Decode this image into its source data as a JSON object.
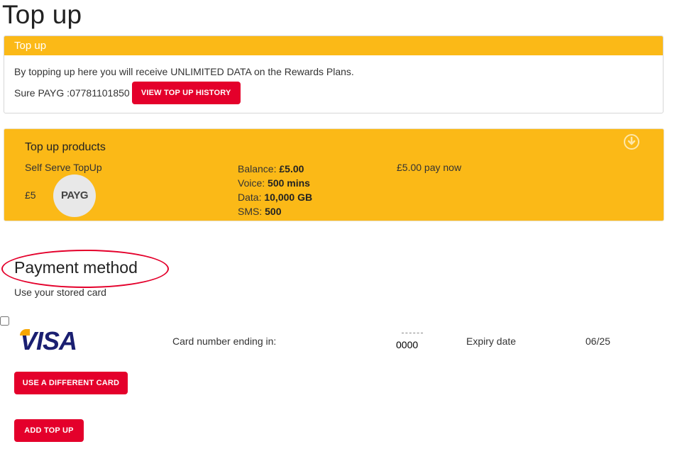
{
  "page": {
    "title": "Top up"
  },
  "topup_panel": {
    "header": "Top up",
    "info": "By topping up here you will receive UNLIMITED DATA on the Rewards Plans.",
    "account": "Sure PAYG :07781101850",
    "history_button": "VIEW TOP UP HISTORY"
  },
  "products": {
    "title": "Top up products",
    "name": "Self Serve TopUp",
    "price": "£5",
    "badge": "PAYG",
    "balance_label": "Balance: ",
    "balance_value": "£5.00",
    "voice_label": "Voice: ",
    "voice_value": "500 mins",
    "data_label": "Data: ",
    "data_value": "10,000 GB",
    "sms_label": "SMS: ",
    "sms_value": "500",
    "pay_now": "£5.00 pay now",
    "icon": "download-circle-icon"
  },
  "payment": {
    "title": "Payment method",
    "subtitle": "Use your stored card",
    "card_brand": "VISA",
    "card_number_label": "Card number ending in:",
    "card_number": "0000",
    "expiry_label": "Expiry date",
    "expiry_value": "06/25",
    "different_card_button": "USE A DIFFERENT CARD",
    "add_topup_button": "ADD TOP UP"
  },
  "colors": {
    "accent_yellow": "#fbb917",
    "button_red": "#e4002b",
    "visa_blue": "#1a1f71"
  }
}
